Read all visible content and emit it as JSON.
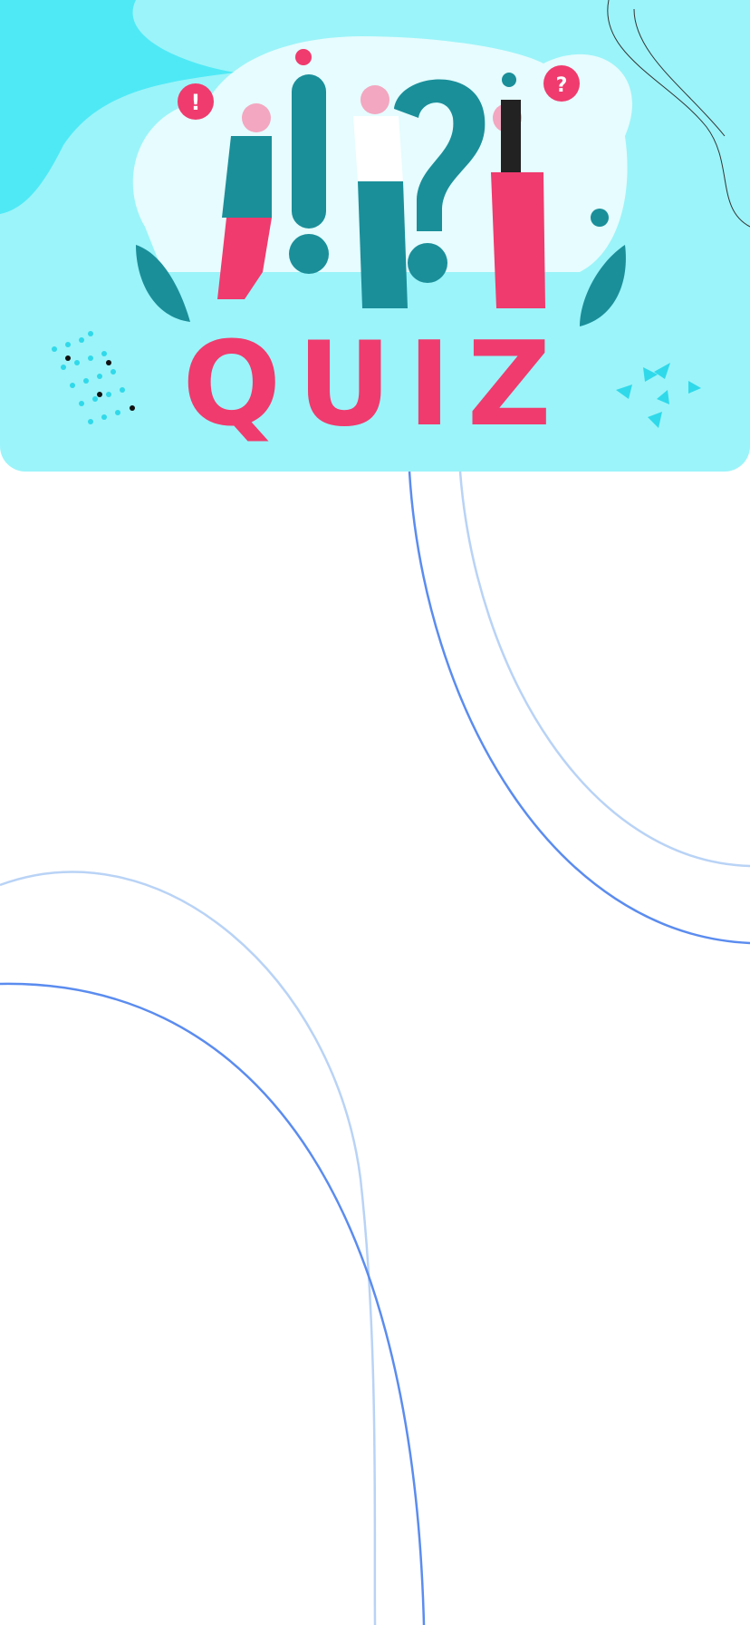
{
  "banner": {
    "title_art": "QUIZ",
    "symbols": [
      "!",
      "?"
    ],
    "colors": {
      "background": "#9bf4f9",
      "accent_pink": "#ef3b6e",
      "teal": "#1a8f9a",
      "blob": "#4fe9f6"
    }
  },
  "decor": {
    "line_dark": "#5b8cef",
    "line_light": "#b9d3f6"
  }
}
